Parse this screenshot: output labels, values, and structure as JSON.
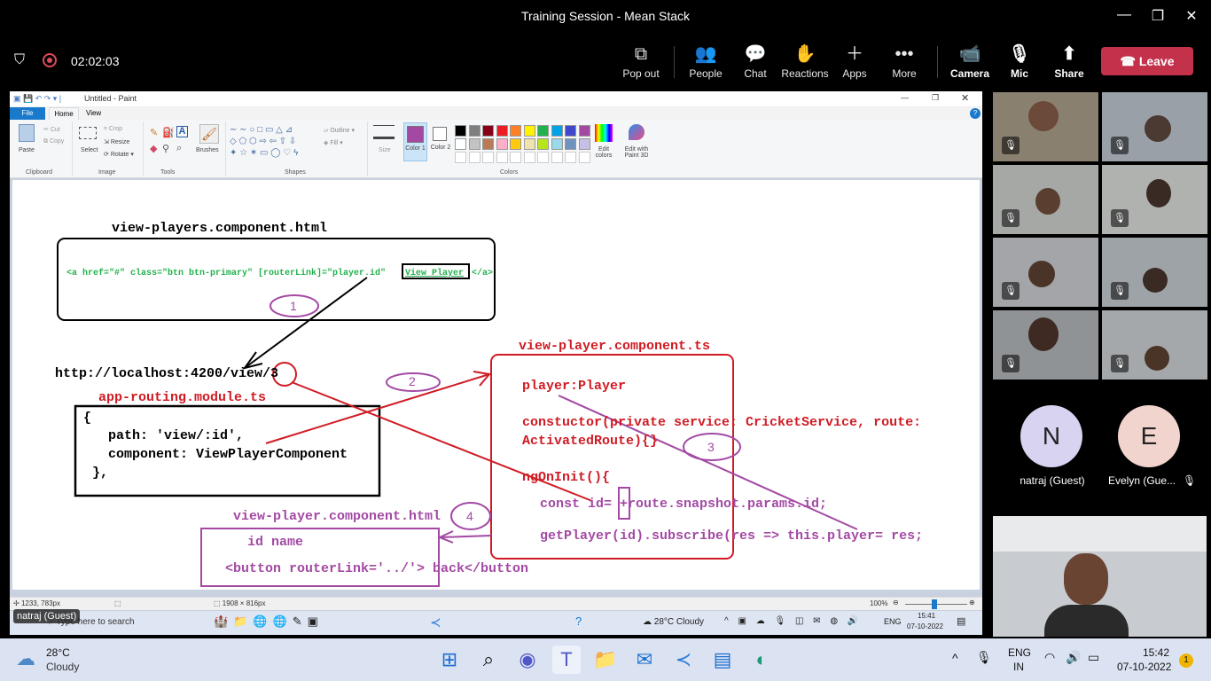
{
  "window": {
    "title": "Training Session - Mean Stack"
  },
  "meeting": {
    "timer": "02:02:03",
    "buttons": {
      "popout": "Pop out",
      "people": "People",
      "chat": "Chat",
      "reactions": "Reactions",
      "apps": "Apps",
      "more": "More",
      "camera": "Camera",
      "mic": "Mic",
      "share": "Share"
    },
    "leave": "Leave"
  },
  "paint": {
    "doc_title": "Untitled - Paint",
    "tabs": [
      "File",
      "Home",
      "View"
    ],
    "ribbon": {
      "paste": "Paste",
      "cut": "Cut",
      "copy": "Copy",
      "clipboard": "Clipboard",
      "select": "Select",
      "crop": "Crop",
      "resize": "Resize",
      "rotate": "Rotate",
      "image": "Image",
      "tools": "Tools",
      "brushes": "Brushes",
      "shapes": "Shapes",
      "outline": "Outline",
      "fill": "Fill",
      "size": "Size",
      "color1": "Color 1",
      "color2": "Color 2",
      "colors": "Colors",
      "edit_colors": "Edit colors",
      "paint3d": "Edit with Paint 3D"
    },
    "palette": [
      "#000000",
      "#7f7f7f",
      "#880015",
      "#ed1c24",
      "#ff7f27",
      "#fff200",
      "#22b14c",
      "#00a2e8",
      "#3f48cc",
      "#a349a4",
      "#ffffff",
      "#c3c3c3",
      "#b97a57",
      "#ffaec9",
      "#ffc90e",
      "#efe4b0",
      "#b5e61d",
      "#99d9ea",
      "#7092be",
      "#c8bfe7"
    ],
    "status": {
      "cursor": "1233, 783px",
      "size": "1908 × 816px",
      "zoom": "100%"
    },
    "inner_taskbar": {
      "search": "Type here to search",
      "weather": "28°C Cloudy",
      "lang": "ENG",
      "time": "15:41",
      "date": "07-10-2022"
    }
  },
  "drawing": {
    "html_file": "view-players.component.html",
    "anchor_code": "<a href=\"#\" class=\"btn btn-primary\" [routerLink]=\"player.id\"",
    "anchor_text": "View Player",
    "anchor_end": "</a>",
    "url": "http://localhost:4200/view/3",
    "routing_file": "app-routing.module.ts",
    "route_lines": [
      "{",
      "path: 'view/:id',",
      "component: ViewPlayerComponent",
      "},"
    ],
    "ts_file": "view-player.component.ts",
    "ts_lines": [
      "player:Player",
      "constuctor(private service: CricketService, route:",
      "ActivatedRoute){}",
      "ngOnInit(){",
      "const id= +route.snapshot.params.id;",
      "getPlayer(id).subscribe(res => this.player= res;"
    ],
    "comp_file": "view-player.component.html",
    "comp_lines": [
      "id name",
      "<button routerLink='../'> back</button"
    ],
    "markers": [
      "1",
      "2",
      "3",
      "4"
    ]
  },
  "presenter_label": "natraj (Guest)",
  "participants": [
    {
      "initial": "N",
      "name": "natraj (Guest)",
      "color": "#d7d3f0"
    },
    {
      "initial": "E",
      "name": "Evelyn (Gue...",
      "color": "#f2d4cf"
    }
  ],
  "taskbar": {
    "temp": "28°C",
    "weather": "Cloudy",
    "lang1": "ENG",
    "lang2": "IN",
    "time": "15:42",
    "date": "07-10-2022",
    "badge": "1"
  }
}
